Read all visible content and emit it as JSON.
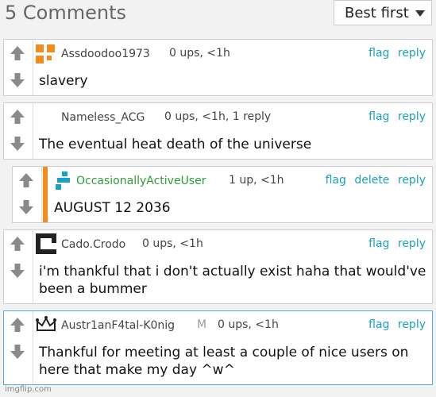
{
  "header": {
    "title": "5 Comments",
    "sort_label": "Best first"
  },
  "comments": [
    {
      "username": "Assdoodoo1973",
      "meta": "0 ups, <1h",
      "flag": "flag",
      "reply": "reply",
      "text": "slavery"
    },
    {
      "username": "Nameless_ACG",
      "meta": "0 ups, <1h, 1 reply",
      "flag": "flag",
      "reply": "reply",
      "text": "The eventual heat death of the universe"
    },
    {
      "username": "OccasionallyActiveUser",
      "meta": "1 up, <1h",
      "flag": "flag",
      "delete": "delete",
      "reply": "reply",
      "text": "AUGUST 12 2036"
    },
    {
      "username": "Cado.Crodo",
      "meta": "0 ups, <1h",
      "flag": "flag",
      "reply": "reply",
      "text_line1": "i'm thankful that i don't actually exist haha that would've",
      "text_line2": "been a bummer"
    },
    {
      "username": "Austr1anF4tal-K0nig",
      "badge": "M",
      "meta": "0 ups, <1h",
      "flag": "flag",
      "reply": "reply",
      "text_line1": "Thankful for meeting at least a couple of nice users on",
      "text_line2": "here that make my day ^w^"
    }
  ],
  "watermark": "imgflip.com",
  "colors": {
    "link": "#1aa0c4",
    "accent_bar": "#f28c1c",
    "mod_name": "#2e9d38",
    "highlight_border": "#5aa9d6"
  }
}
